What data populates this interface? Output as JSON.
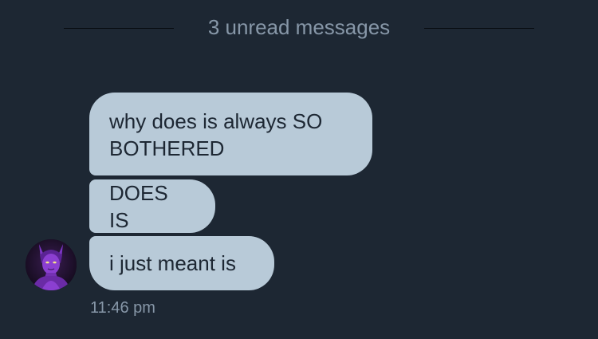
{
  "divider": {
    "label": "3 unread messages"
  },
  "messages": [
    {
      "text_lines": [
        "why does is always SO",
        "BOTHERED"
      ]
    },
    {
      "text": "DOES IS"
    },
    {
      "text": "i just meant is"
    }
  ],
  "timestamp": "11:46 pm",
  "avatar": {
    "icon": "purple-horned-character-avatar"
  },
  "colors": {
    "background": "#1d2733",
    "bubble": "#b8cad8",
    "bubble_text": "#1d2733",
    "muted_text": "#8797a8",
    "avatar_accent": "#8b3fd1"
  }
}
